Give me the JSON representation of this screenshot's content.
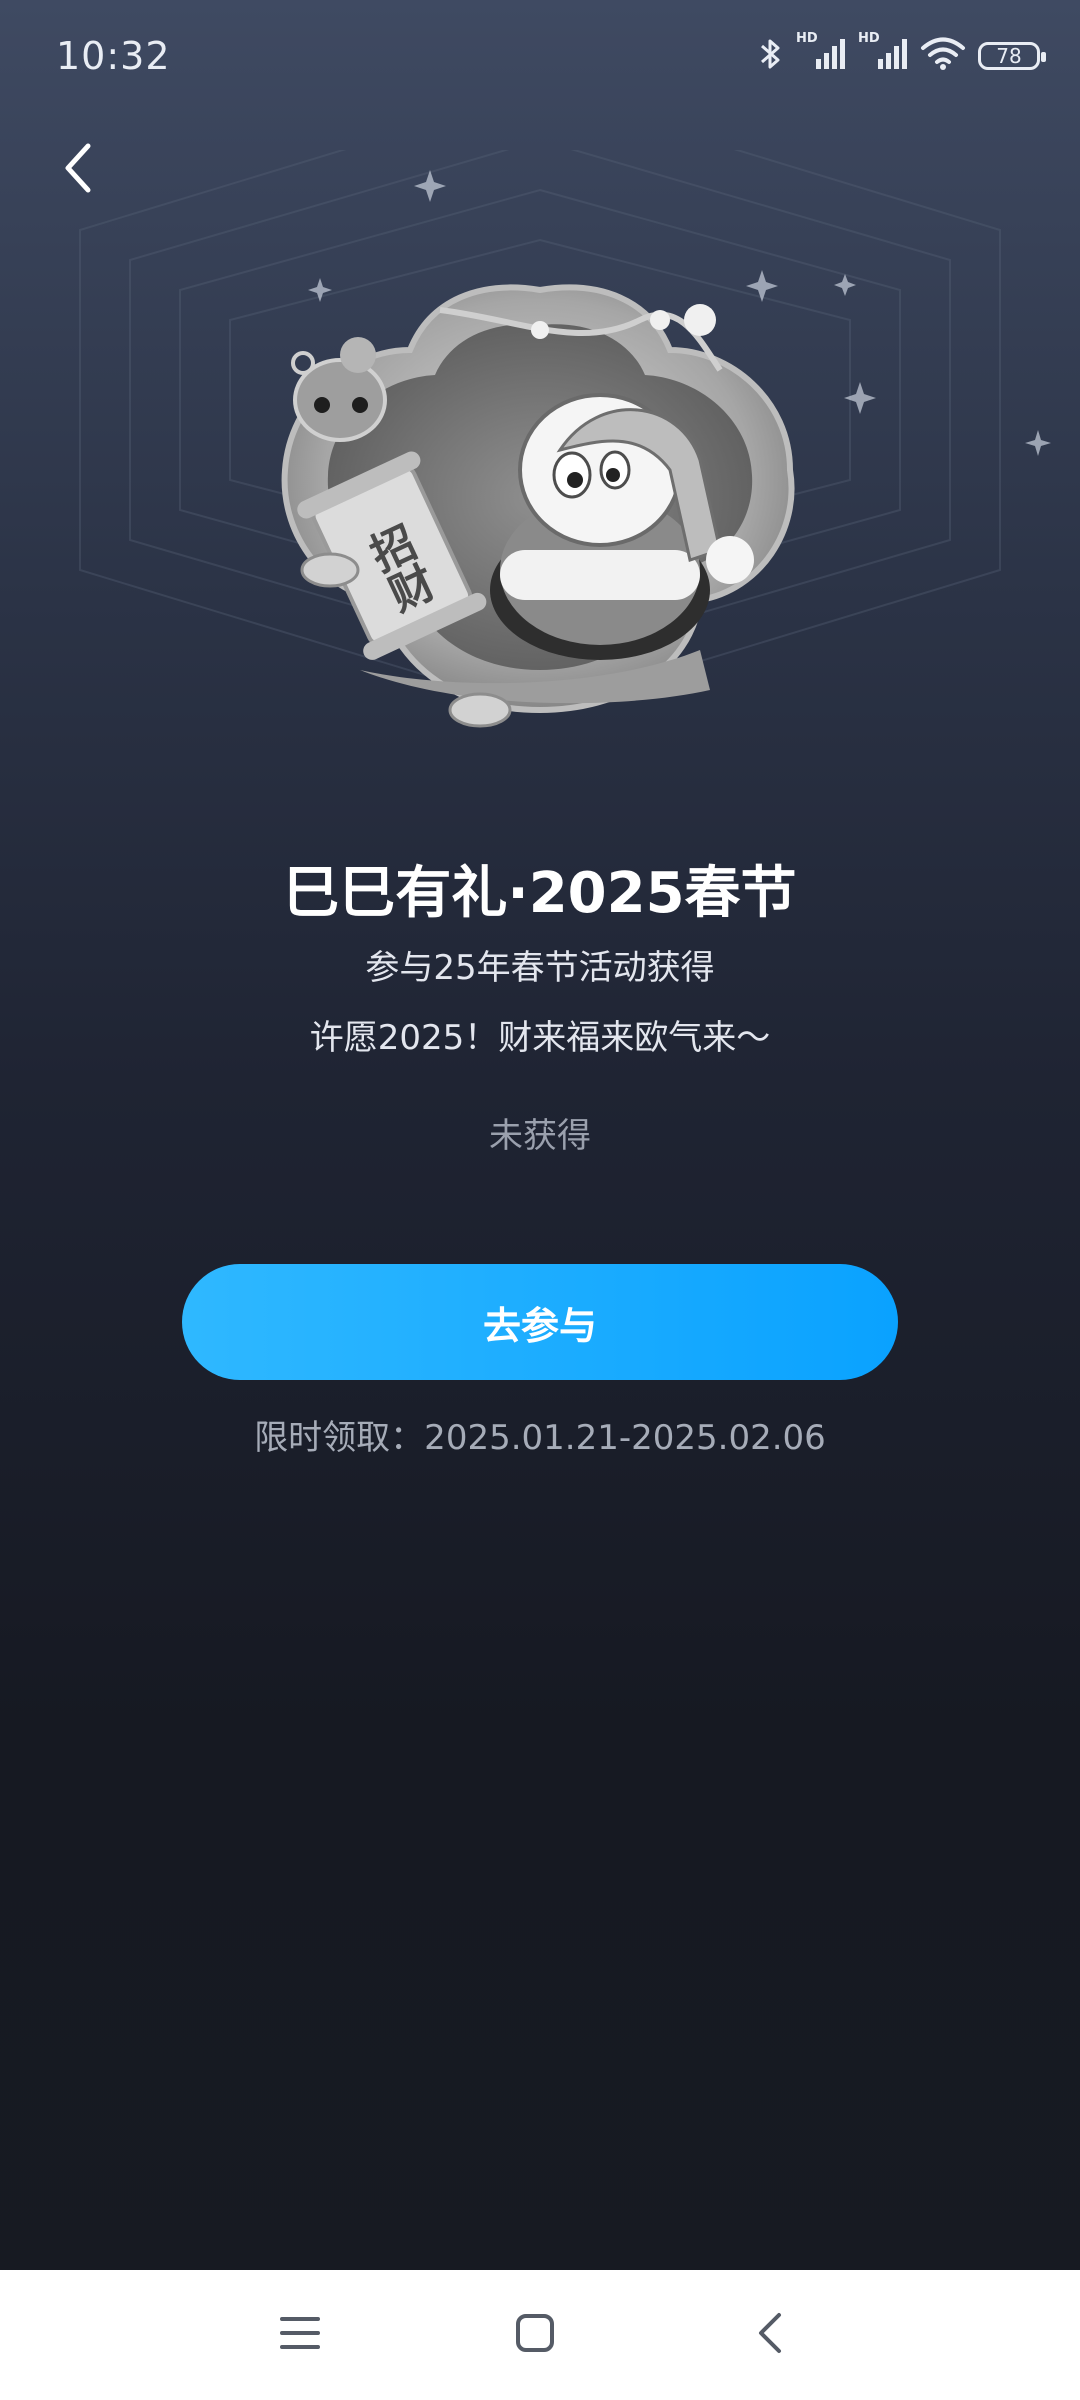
{
  "status_bar": {
    "time": "10:32",
    "battery": "78",
    "network_label_1": "HD",
    "network_label_2": "HD"
  },
  "badge": {
    "scroll_text": "招财"
  },
  "title": "巳巳有礼·2025春节",
  "subtitle": "参与25年春节活动获得",
  "description": "许愿2025！财来福来欧气来～",
  "status": "未获得",
  "join_button": "去参与",
  "period": "限时领取：2025.01.21-2025.02.06",
  "colors": {
    "accent_start": "#2fb8ff",
    "accent_end": "#0aa2ff",
    "background_top": "#3f4a62",
    "background_bottom": "#171a22"
  },
  "icons": [
    "back-arrow-icon",
    "bluetooth-icon",
    "signal-icon",
    "wifi-icon",
    "battery-icon",
    "menu-icon",
    "home-icon",
    "back-icon"
  ]
}
